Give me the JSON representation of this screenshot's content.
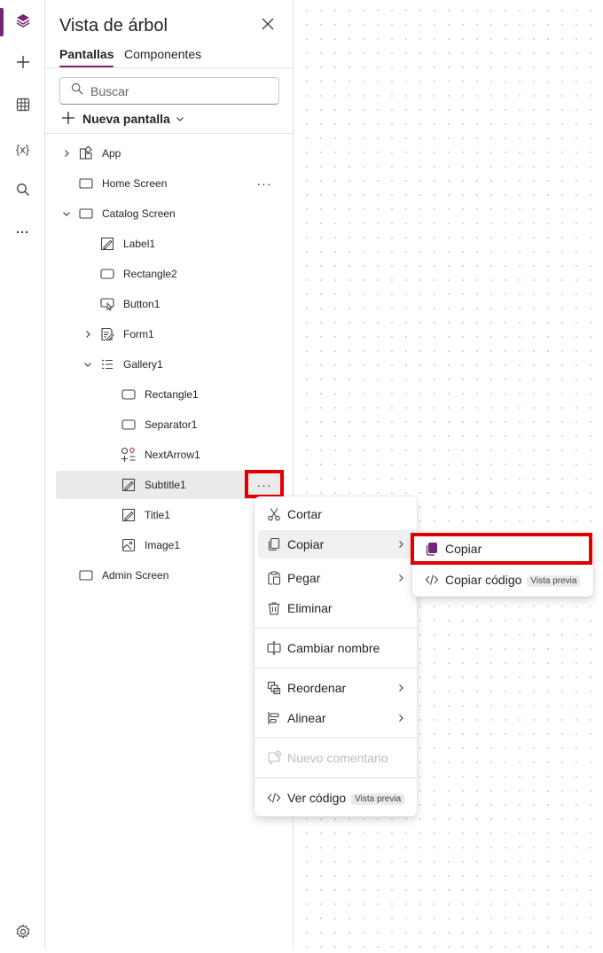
{
  "rail": {
    "items": [
      {
        "name": "tree-view-icon",
        "active": true
      },
      {
        "name": "insert-icon"
      },
      {
        "name": "data-icon"
      },
      {
        "name": "variables-icon",
        "text": "{x}"
      },
      {
        "name": "search-icon"
      },
      {
        "name": "more-icon",
        "text": "···"
      },
      {
        "name": "settings-icon"
      }
    ]
  },
  "panel": {
    "title": "Vista de árbol",
    "tabs": [
      "Pantallas",
      "Componentes"
    ],
    "search_placeholder": "Buscar",
    "new_screen_label": "Nueva pantalla"
  },
  "tree": {
    "items": [
      {
        "label": "App",
        "icon": "app-icon",
        "expander": "right"
      },
      {
        "label": "Home Screen",
        "icon": "screen-icon",
        "more": "···"
      },
      {
        "label": "Catalog Screen",
        "icon": "screen-icon",
        "expander": "down"
      },
      {
        "label": "Label1",
        "icon": "label-icon"
      },
      {
        "label": "Rectangle2",
        "icon": "rectangle-icon"
      },
      {
        "label": "Button1",
        "icon": "button-icon"
      },
      {
        "label": "Form1",
        "icon": "form-icon",
        "expander": "right"
      },
      {
        "label": "Gallery1",
        "icon": "gallery-icon",
        "expander": "down"
      },
      {
        "label": "Rectangle1",
        "icon": "rectangle-icon"
      },
      {
        "label": "Separator1",
        "icon": "rectangle-icon"
      },
      {
        "label": "NextArrow1",
        "icon": "icon-control-icon"
      },
      {
        "label": "Subtitle1",
        "icon": "label-icon",
        "selected": true,
        "more": "···"
      },
      {
        "label": "Title1",
        "icon": "label-icon"
      },
      {
        "label": "Image1",
        "icon": "image-icon"
      },
      {
        "label": "Admin Screen",
        "icon": "screen-icon"
      }
    ]
  },
  "context_menu": {
    "items": [
      {
        "label": "Cortar",
        "icon": "cut-icon"
      },
      {
        "label": "Copiar",
        "icon": "copy-icon",
        "submenu": true
      },
      {
        "label": "Pegar",
        "icon": "paste-icon",
        "submenu": true
      },
      {
        "label": "Eliminar",
        "icon": "delete-icon"
      },
      {
        "label": "Cambiar nombre",
        "icon": "rename-icon"
      },
      {
        "label": "Reordenar",
        "icon": "reorder-icon",
        "submenu": true
      },
      {
        "label": "Alinear",
        "icon": "align-icon",
        "submenu": true
      },
      {
        "label": "Nuevo comentario",
        "icon": "comment-icon",
        "disabled": true
      },
      {
        "label": "Ver código",
        "icon": "code-icon",
        "badge": "Vista previa"
      }
    ]
  },
  "submenu": {
    "items": [
      {
        "label": "Copiar",
        "icon": "copy-filled-icon"
      },
      {
        "label": "Copiar código",
        "icon": "code-icon",
        "badge": "Vista previa"
      }
    ]
  },
  "colors": {
    "accent": "#742774",
    "highlight": "#e00000"
  }
}
